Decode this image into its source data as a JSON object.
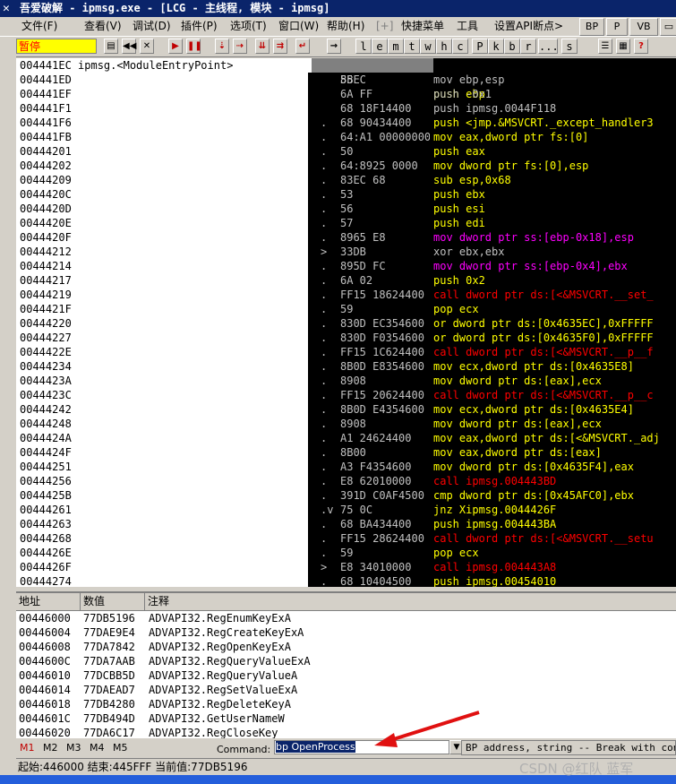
{
  "window": {
    "title": "吾爱破解 - ipmsg.exe - [LCG - 主线程, 模块 - ipmsg]"
  },
  "menu": {
    "items": [
      "文件(F)",
      "查看(V)",
      "调试(D)",
      "插件(P)",
      "选项(T)",
      "窗口(W)",
      "帮助(H)",
      "[+]",
      "快捷菜单",
      "工具",
      "设置API断点>"
    ],
    "right_buttons": [
      "BP",
      "P",
      "VB"
    ]
  },
  "toolbar": {
    "status": "暂停",
    "letter_buttons": [
      "l",
      "e",
      "m",
      "t",
      "w",
      "h",
      "c",
      "P",
      "k",
      "b",
      "r",
      "...",
      "s"
    ]
  },
  "disasm": {
    "header": "004441EC ipmsg.<ModuleEntryPoint>",
    "rows": [
      {
        "addr": "004441ED",
        "mark": "",
        "hex": "8BEC",
        "instr": "mov ebp,esp",
        "color": "#c0c0c0"
      },
      {
        "addr": "004441EF",
        "mark": "",
        "hex": "6A FF",
        "instr": "push -0x1",
        "color": "#c0c0c0"
      },
      {
        "addr": "004441F1",
        "mark": "",
        "hex": "68 18F14400",
        "instr": "push ipmsg.0044F118",
        "color": "#c0c0c0"
      },
      {
        "addr": "004441F6",
        "mark": ".",
        "hex": "68 90434400",
        "instr": "push <jmp.&MSVCRT._except_handler3",
        "color": "#ffff00"
      },
      {
        "addr": "004441FB",
        "mark": ".",
        "hex": "64:A1 00000000",
        "instr": "mov eax,dword ptr fs:[0]",
        "color": "#ffff00"
      },
      {
        "addr": "00444201",
        "mark": ".",
        "hex": "50",
        "instr": "push eax",
        "color": "#ffff00"
      },
      {
        "addr": "00444202",
        "mark": ".",
        "hex": "64:8925 0000",
        "instr": "mov dword ptr fs:[0],esp",
        "color": "#ffff00"
      },
      {
        "addr": "00444209",
        "mark": ".",
        "hex": "83EC 68",
        "instr": "sub esp,0x68",
        "color": "#ffff00"
      },
      {
        "addr": "0044420C",
        "mark": ".",
        "hex": "53",
        "instr": "push ebx",
        "color": "#ffff00"
      },
      {
        "addr": "0044420D",
        "mark": ".",
        "hex": "56",
        "instr": "push esi",
        "color": "#ffff00"
      },
      {
        "addr": "0044420E",
        "mark": ".",
        "hex": "57",
        "instr": "push edi",
        "color": "#ffff00"
      },
      {
        "addr": "0044420F",
        "mark": ".",
        "hex": "8965 E8",
        "instr": "mov dword ptr ss:[ebp-0x18],esp",
        "color": "#ff00ff"
      },
      {
        "addr": "00444212",
        "mark": ">",
        "hex": "33DB",
        "instr": "xor ebx,ebx",
        "color": "#c0c0c0"
      },
      {
        "addr": "00444214",
        "mark": ".",
        "hex": "895D FC",
        "instr": "mov dword ptr ss:[ebp-0x4],ebx",
        "color": "#ff00ff"
      },
      {
        "addr": "00444217",
        "mark": ".",
        "hex": "6A 02",
        "instr": "push 0x2",
        "color": "#ffff00"
      },
      {
        "addr": "00444219",
        "mark": ".",
        "hex": "FF15 18624400",
        "instr": "call dword ptr ds:[<&MSVCRT.__set_",
        "color": "#ff0000"
      },
      {
        "addr": "0044421F",
        "mark": ".",
        "hex": "59",
        "instr": "pop ecx",
        "color": "#ffff00"
      },
      {
        "addr": "00444220",
        "mark": ".",
        "hex": "830D EC354600",
        "instr": "or dword ptr ds:[0x4635EC],0xFFFFF",
        "color": "#ffff00"
      },
      {
        "addr": "00444227",
        "mark": ".",
        "hex": "830D F0354600",
        "instr": "or dword ptr ds:[0x4635F0],0xFFFFF",
        "color": "#ffff00"
      },
      {
        "addr": "0044422E",
        "mark": ".",
        "hex": "FF15 1C624400",
        "instr": "call dword ptr ds:[<&MSVCRT.__p__f",
        "color": "#ff0000"
      },
      {
        "addr": "00444234",
        "mark": ".",
        "hex": "8B0D E8354600",
        "instr": "mov ecx,dword ptr ds:[0x4635E8]",
        "color": "#ffff00"
      },
      {
        "addr": "0044423A",
        "mark": ".",
        "hex": "8908",
        "instr": "mov dword ptr ds:[eax],ecx",
        "color": "#ffff00"
      },
      {
        "addr": "0044423C",
        "mark": ".",
        "hex": "FF15 20624400",
        "instr": "call dword ptr ds:[<&MSVCRT.__p__c",
        "color": "#ff0000"
      },
      {
        "addr": "00444242",
        "mark": ".",
        "hex": "8B0D E4354600",
        "instr": "mov ecx,dword ptr ds:[0x4635E4]",
        "color": "#ffff00"
      },
      {
        "addr": "00444248",
        "mark": ".",
        "hex": "8908",
        "instr": "mov dword ptr ds:[eax],ecx",
        "color": "#ffff00"
      },
      {
        "addr": "0044424A",
        "mark": ".",
        "hex": "A1 24624400",
        "instr": "mov eax,dword ptr ds:[<&MSVCRT._adj",
        "color": "#ffff00"
      },
      {
        "addr": "0044424F",
        "mark": ".",
        "hex": "8B00",
        "instr": "mov eax,dword ptr ds:[eax]",
        "color": "#ffff00"
      },
      {
        "addr": "00444251",
        "mark": ".",
        "hex": "A3 F4354600",
        "instr": "mov dword ptr ds:[0x4635F4],eax",
        "color": "#ffff00"
      },
      {
        "addr": "00444256",
        "mark": ".",
        "hex": "E8 62010000",
        "instr": "call ipmsg.004443BD",
        "color": "#ff0000"
      },
      {
        "addr": "0044425B",
        "mark": ".",
        "hex": "391D C0AF4500",
        "instr": "cmp dword ptr ds:[0x45AFC0],ebx",
        "color": "#ffff00"
      },
      {
        "addr": "00444261",
        "mark": ".v",
        "hex": "75 0C",
        "instr": "jnz Xipmsg.0044426F",
        "color": "#ffff00"
      },
      {
        "addr": "00444263",
        "mark": ".",
        "hex": "68 BA434400",
        "instr": "push ipmsg.004443BA",
        "color": "#ffff00"
      },
      {
        "addr": "00444268",
        "mark": ".",
        "hex": "FF15 28624400",
        "instr": "call dword ptr ds:[<&MSVCRT.__setu",
        "color": "#ff0000"
      },
      {
        "addr": "0044426E",
        "mark": ".",
        "hex": "59",
        "instr": "pop ecx",
        "color": "#ffff00"
      },
      {
        "addr": "0044426F",
        "mark": ">",
        "hex": "E8 34010000",
        "instr": "call ipmsg.004443A8",
        "color": "#ff0000"
      },
      {
        "addr": "00444274",
        "mark": ".",
        "hex": "68 10404500",
        "instr": "push ipmsg.00454010",
        "color": "#ffff00"
      }
    ],
    "first_row": {
      "hex": "55",
      "instr": "push ebp"
    }
  },
  "dump": {
    "headers": [
      "地址",
      "数值",
      "注释"
    ],
    "rows": [
      [
        "00446000",
        "77DB5196",
        "ADVAPI32.RegEnumKeyExA"
      ],
      [
        "00446004",
        "77DAE9E4",
        "ADVAPI32.RegCreateKeyExA"
      ],
      [
        "00446008",
        "77DA7842",
        "ADVAPI32.RegOpenKeyExA"
      ],
      [
        "0044600C",
        "77DA7AAB",
        "ADVAPI32.RegQueryValueExA"
      ],
      [
        "00446010",
        "77DCBB5D",
        "ADVAPI32.RegQueryValueA"
      ],
      [
        "00446014",
        "77DAEAD7",
        "ADVAPI32.RegSetValueExA"
      ],
      [
        "00446018",
        "77DB4280",
        "ADVAPI32.RegDeleteKeyA"
      ],
      [
        "0044601C",
        "77DB494D",
        "ADVAPI32.GetUserNameW"
      ],
      [
        "00446020",
        "77DA6C17",
        "ADVAPI32.RegCloseKey"
      ]
    ]
  },
  "command": {
    "tabs": [
      "M1",
      "M2",
      "M3",
      "M4",
      "M5"
    ],
    "label": "Command:",
    "value": "bp OpenProcess",
    "hint": "BP address, string -- Break with condition"
  },
  "status": {
    "text": "起始:446000 结束:445FFF 当前值:77DB5196"
  },
  "watermark": "CSDN @红队 蓝军",
  "colors": {
    "title_bg": "#0a246a",
    "status_pause_bg": "#ffff00",
    "annotation_arrow": "#e01010"
  }
}
